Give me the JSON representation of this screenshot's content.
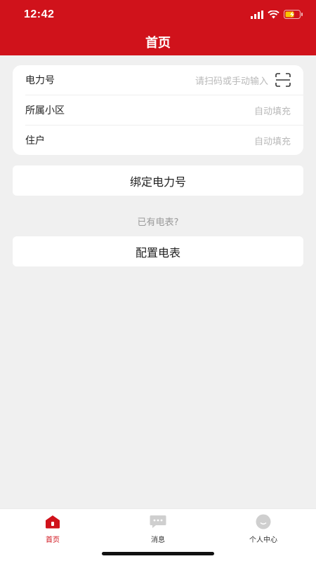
{
  "status_bar": {
    "time": "12:42"
  },
  "header": {
    "title": "首页"
  },
  "form": {
    "power_number": {
      "label": "电力号",
      "placeholder": "请扫码或手动输入"
    },
    "community": {
      "label": "所属小区",
      "value": "自动填充"
    },
    "resident": {
      "label": "住户",
      "value": "自动填充"
    }
  },
  "actions": {
    "bind_label": "绑定电力号",
    "hint": "已有电表?",
    "config_label": "配置电表"
  },
  "tabbar": {
    "items": [
      {
        "label": "首页",
        "icon": "home-icon",
        "active": true
      },
      {
        "label": "消息",
        "icon": "message-icon",
        "active": false
      },
      {
        "label": "个人中心",
        "icon": "profile-icon",
        "active": false
      }
    ]
  },
  "colors": {
    "brand": "#d0121b",
    "background": "#f0f0f0",
    "placeholder": "#b9b9b9"
  }
}
